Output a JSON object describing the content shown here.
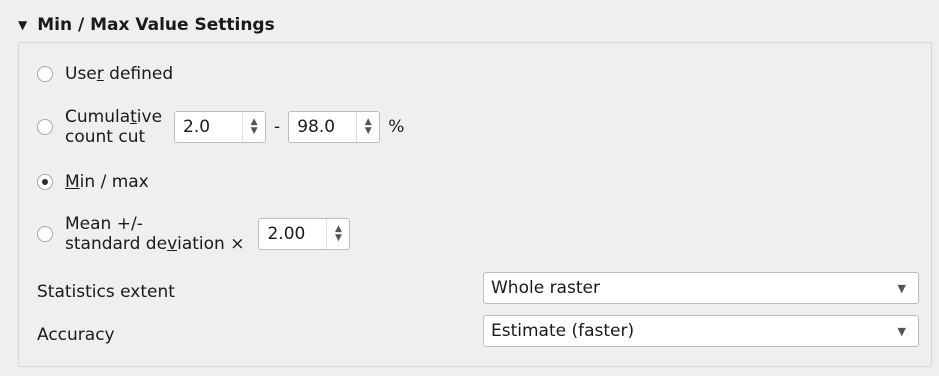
{
  "group": {
    "title": "Min / Max Value Settings"
  },
  "options": {
    "user_defined": {
      "pre": "Use",
      "ul": "r",
      "post": " defined"
    },
    "cumulative": {
      "line1_pre": "Cumula",
      "line1_ul": "t",
      "line1_post": "ive",
      "line2": "count cut",
      "min_value": "2.0",
      "separator": "-",
      "max_value": "98.0",
      "unit": "%"
    },
    "min_max": {
      "ul": "M",
      "post": "in / max",
      "selected": true
    },
    "mean_std": {
      "line1": "Mean +/-",
      "line2_pre": "standard de",
      "line2_ul": "v",
      "line2_post": "iation ×",
      "value": "2.00"
    }
  },
  "statistics_extent": {
    "label": "Statistics extent",
    "value": "Whole raster"
  },
  "accuracy": {
    "label": "Accuracy",
    "value": "Estimate (faster)"
  },
  "icons": {
    "collapse": "triangle-down-icon",
    "spin": "up-down-arrows-icon",
    "dropdown": "chevron-down-icon"
  }
}
